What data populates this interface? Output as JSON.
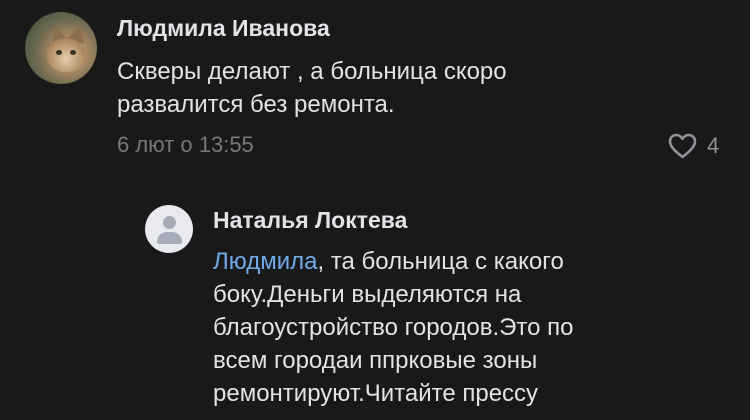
{
  "comments": [
    {
      "author": "Людмила Иванова",
      "avatar_icon": "profile-photo",
      "text_lines": [
        "Скверы делают , а больница скоро",
        "развалится без ремонта."
      ],
      "timestamp": "6 лют о 13:55",
      "like_icon": "heart-outline-icon",
      "like_count": "4"
    }
  ],
  "reply": {
    "author": "Наталья Локтева",
    "avatar_icon": "default-user-icon",
    "mention": "Людмила",
    "text_lines": [
      ", та больница с какого",
      "боку.Деньги выделяются на",
      "благоустройство городов.Это по",
      "всем городаи ппрковые зоны",
      "ремонтируют.Читайте прессу"
    ]
  },
  "colors": {
    "background": "#19191a",
    "text_primary": "#e1e3e6",
    "text_secondary": "#76787a",
    "link": "#71aaeb"
  }
}
